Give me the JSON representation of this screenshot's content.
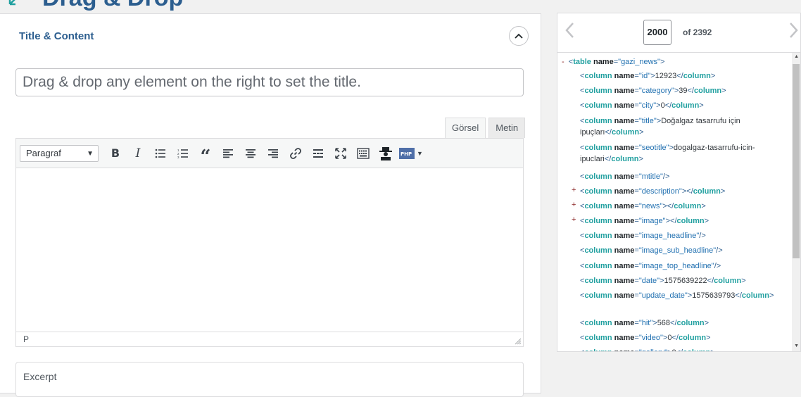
{
  "page": {
    "title": "Drag & Drop"
  },
  "section": {
    "title": "Title & Content"
  },
  "title_field": {
    "placeholder": "Drag & drop any element on the right to set the title."
  },
  "editor": {
    "tabs": [
      {
        "label": "Görsel",
        "active": true
      },
      {
        "label": "Metin",
        "active": false
      }
    ],
    "format_select": "Paragraf",
    "toolbar_icons": [
      "bold-icon",
      "italic-icon",
      "bullet-list-icon",
      "numbered-list-icon",
      "blockquote-icon",
      "align-left-icon",
      "align-center-icon",
      "align-right-icon",
      "link-icon",
      "read-more-icon",
      "fullscreen-icon",
      "toolbar-toggle-icon",
      "spy-icon",
      "php-icon"
    ],
    "status_path": "P"
  },
  "excerpt": {
    "label": "Excerpt"
  },
  "record_nav": {
    "current": "2000",
    "total_label": "of 2392"
  },
  "xml": {
    "table_tag": "table",
    "table_name": "gazi_news",
    "lines": [
      {
        "name": "id",
        "value": "12923"
      },
      {
        "name": "category",
        "value": "39"
      },
      {
        "name": "city",
        "value": "0"
      },
      {
        "name": "title",
        "value": "Doğalgaz tasarrufu için ipuçları"
      },
      {
        "name": "seotitle",
        "value": "dogalgaz-tasarrufu-icin-ipuclari"
      },
      {
        "name": "mtitle",
        "value": ""
      },
      {
        "name": "description",
        "value": ""
      },
      {
        "name": "news",
        "value": ""
      },
      {
        "name": "image",
        "value": ""
      },
      {
        "name": "image_headline",
        "value": ""
      },
      {
        "name": "image_sub_headline",
        "value": ""
      },
      {
        "name": "image_top_headline",
        "value": ""
      },
      {
        "name": "date",
        "value": "1575639222"
      },
      {
        "name": "update_date",
        "value": "1575639793"
      },
      {
        "name": "hit",
        "value": "568"
      },
      {
        "name": "video",
        "value": "0"
      },
      {
        "name": "gallery",
        "value": "0"
      }
    ]
  },
  "colors": {
    "accent": "#2c5e8f",
    "xml_keyword": "#21a0a0",
    "xml_value": "#2271b1"
  }
}
